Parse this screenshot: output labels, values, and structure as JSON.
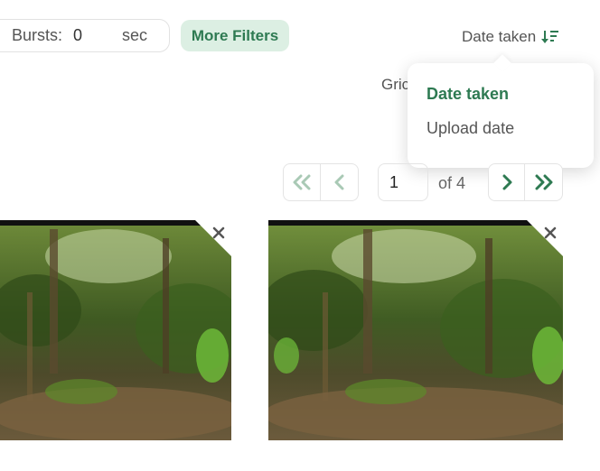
{
  "filters": {
    "bursts_label": "Bursts:",
    "bursts_value": "0",
    "bursts_unit": "sec",
    "more_filters_label": "More Filters"
  },
  "sort": {
    "current_label": "Date taken",
    "icon": "sort-descending-icon",
    "dropdown_options": [
      "Date taken",
      "Upload date"
    ],
    "selected_option": "Date taken"
  },
  "view": {
    "grid_label_partial": "Gric"
  },
  "pagination": {
    "current_page": "1",
    "of_label": "of 4"
  },
  "colors": {
    "accent": "#2e7a52",
    "accent_bg": "#dcefe3"
  }
}
